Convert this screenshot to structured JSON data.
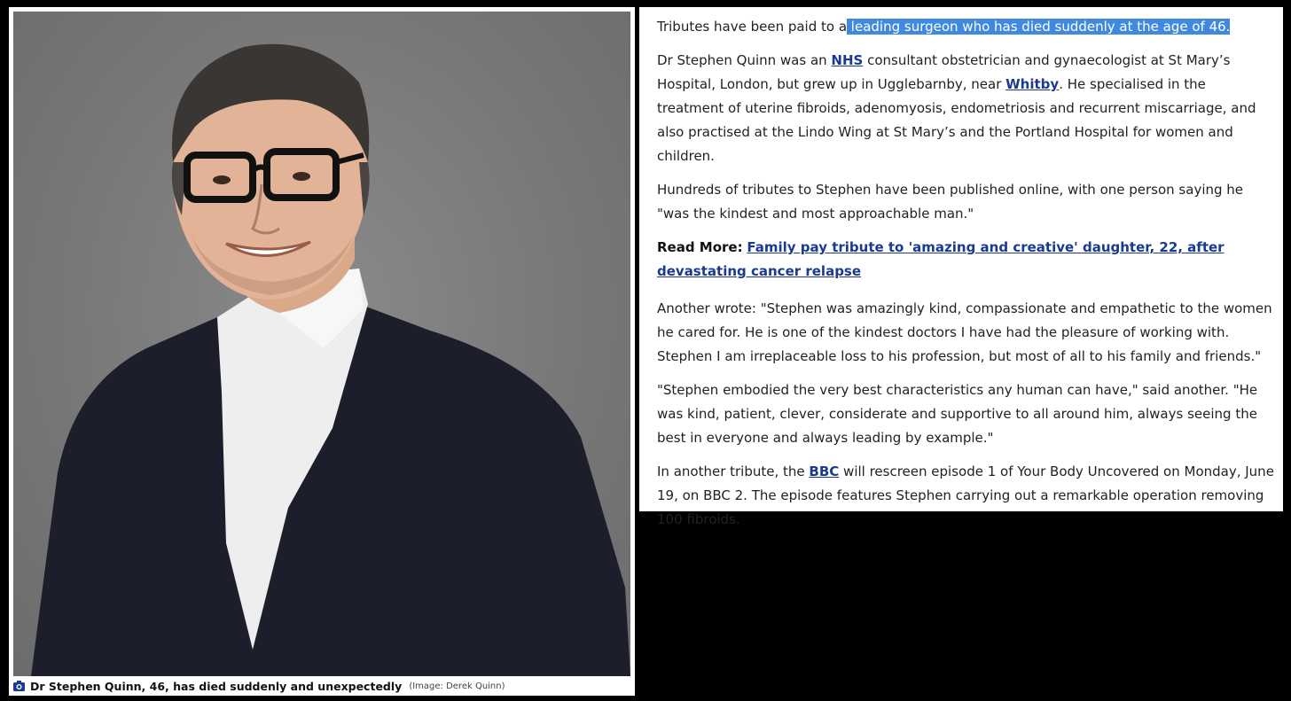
{
  "photo": {
    "caption": "Dr Stephen Quinn, 46, has died suddenly and unexpectedly",
    "credit": "(Image: Derek Quinn)",
    "icon": "camera-icon"
  },
  "article": {
    "p1": {
      "before": "Tributes have been paid to a",
      "highlighted": " leading surgeon who has died suddenly at the age of 46."
    },
    "p2": {
      "t1": "Dr Stephen Quinn was an ",
      "link1": "NHS",
      "t2": " consultant obstetrician and gynaecologist at St Mary’s Hospital, London, but grew up in Ugglebarnby, near ",
      "link2": "Whitby",
      "t3": ". He specialised in the treatment of uterine fibroids, adenomyosis, endometriosis and recurrent miscarriage, and also practised at the Lindo Wing at St Mary’s and the Portland Hospital for women and children."
    },
    "p3": "Hundreds of tributes to Stephen have been published online, with one person saying he \"was the kindest and most approachable man.\"",
    "read_more": {
      "label": "Read More:",
      "link": "Family pay tribute to 'amazing and creative' daughter, 22, after devastating cancer relapse"
    },
    "p4": "Another wrote: \"Stephen was amazingly kind, compassionate and empathetic to the women he cared for. He is one of the kindest doctors I have had the pleasure of working with. Stephen I am irreplaceable loss to his profession, but most of all to his family and friends.\"",
    "p5": "\"Stephen embodied the very best characteristics any human can have,\" said another. \"He was kind, patient, clever, considerate and supportive to all around him, always seeing the best in everyone and always leading by example.\"",
    "p6": {
      "t1": "In another tribute, the ",
      "link": "BBC",
      "t2": " will rescreen episode 1 of Your Body Uncovered on Monday, June 19, on BBC 2. The episode features Stephen carrying out a remarkable operation removing 100 fibroids."
    }
  },
  "colors": {
    "link": "#1a3a8f",
    "selection": "#3f8ae0",
    "photo_background": "#777777"
  }
}
